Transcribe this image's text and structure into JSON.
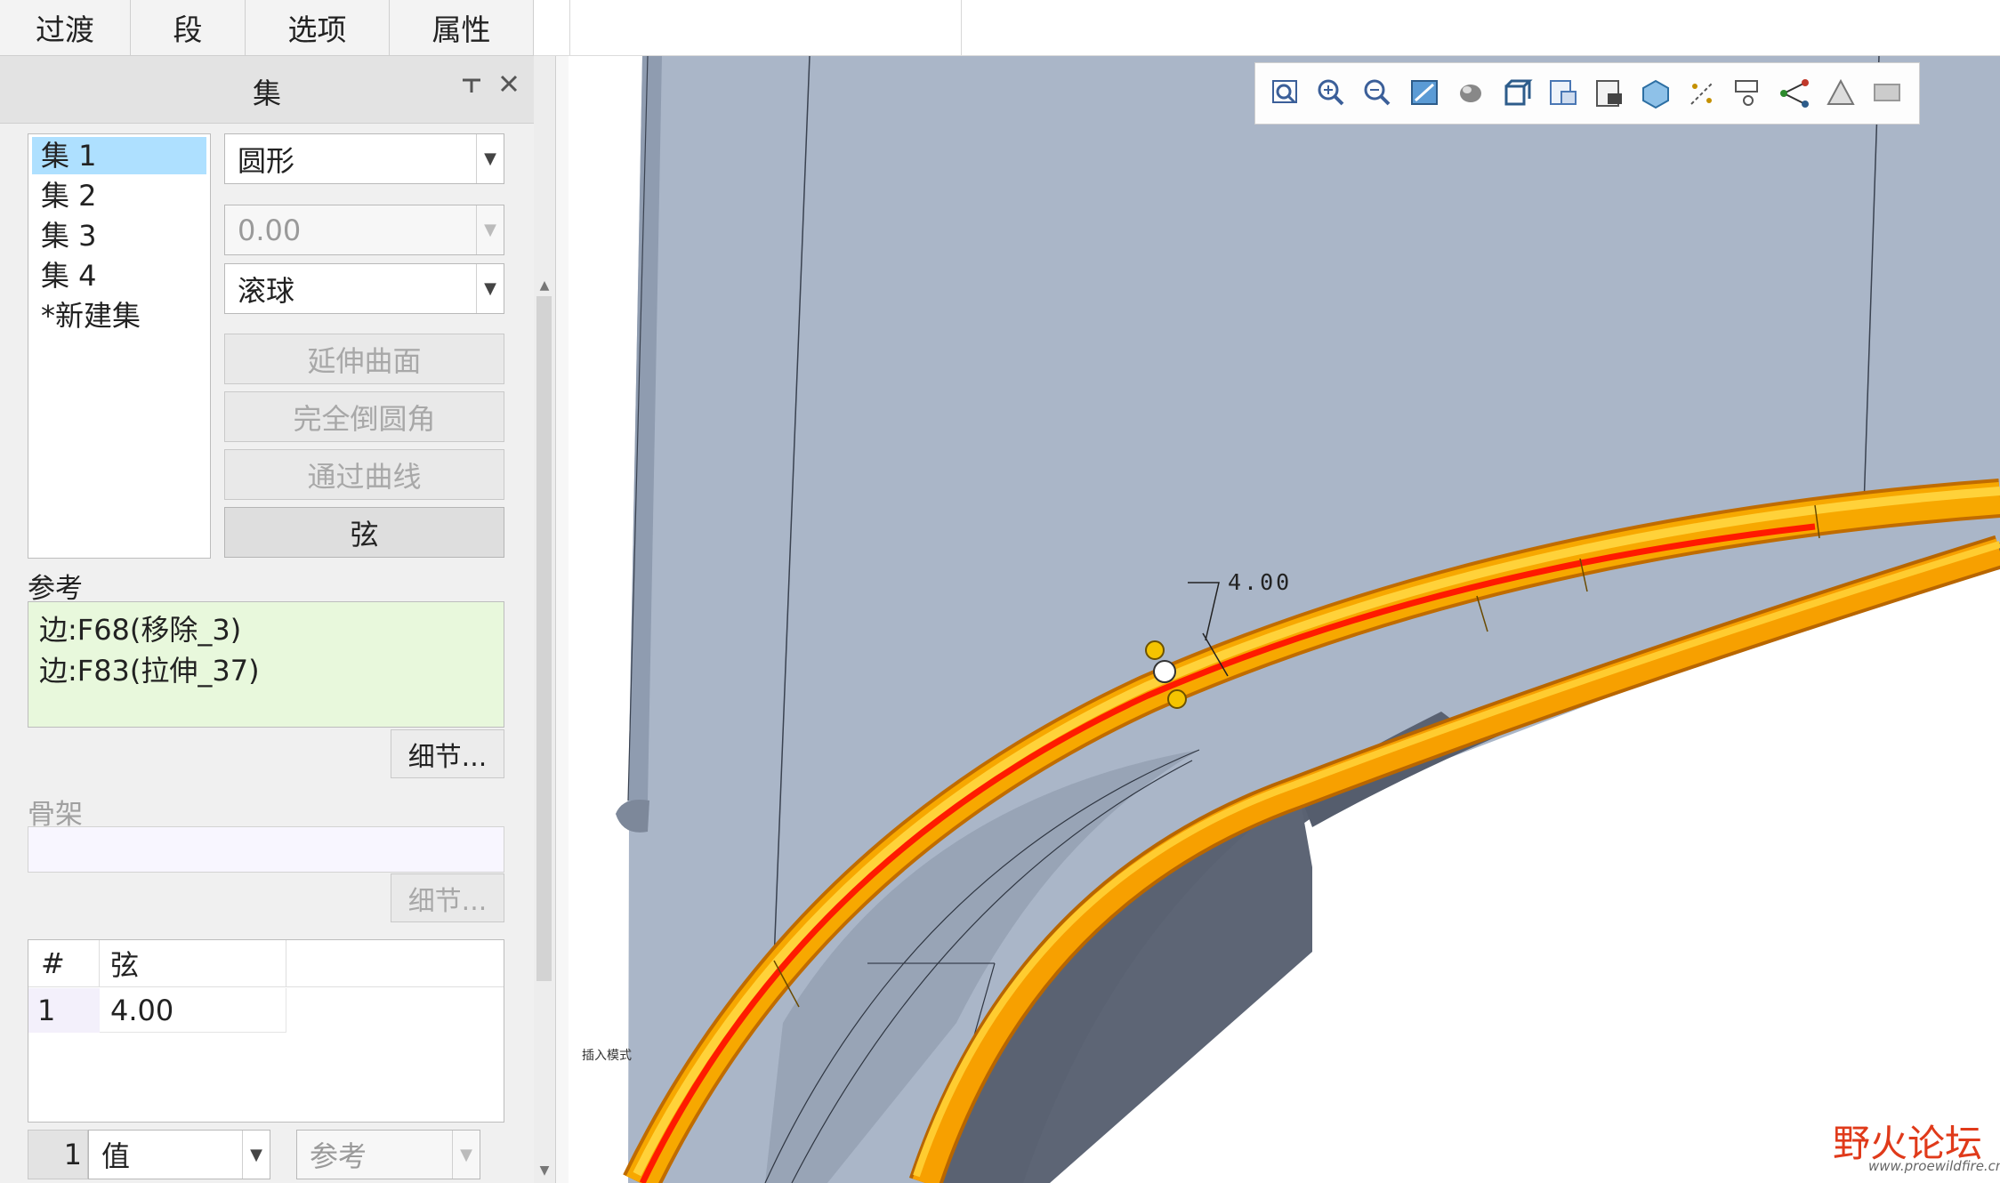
{
  "tabs": [
    "过渡",
    "段",
    "选项",
    "属性"
  ],
  "panel": {
    "title": "集",
    "pin_icon": "pin-icon",
    "close_icon": "close-icon",
    "sets": [
      "集 1",
      "集 2",
      "集 3",
      "集 4",
      "*新建集"
    ],
    "selected_set": "集 1",
    "shape_combo": "圆形",
    "value_combo": "0.00",
    "method_combo": "滚球",
    "buttons": [
      "延伸曲面",
      "完全倒圆角",
      "通过曲线",
      "弦"
    ],
    "references_label": "参考",
    "references": [
      "边:F68(移除_3)",
      "边:F83(拉伸_37)"
    ],
    "details_button": "细节...",
    "skeleton_label": "骨架",
    "skeleton_details_button": "细节...",
    "table": {
      "headers": [
        "#",
        "弦"
      ],
      "rows": [
        {
          "num": "1",
          "value": "4.00"
        }
      ]
    },
    "bottom": {
      "index": "1",
      "value_combo": "值",
      "ref_combo": "参考"
    }
  },
  "viewport": {
    "dimension_label": "4.00",
    "insert_mode_label": "插入模式",
    "toolbar_icons": [
      "refit-icon",
      "zoom-in-icon",
      "zoom-out-icon",
      "repaint-icon",
      "display-style-icon",
      "saved-orientations-icon",
      "view-manager-icon",
      "perspective-icon",
      "datum-display-icon",
      "annotation-display-icon",
      "point-display-icon",
      "csys-display-icon",
      "spin-center-icon",
      "appearance-icon"
    ],
    "colors": {
      "model": "#a9b5c6",
      "fillet": "#f5a800",
      "highlight_edge": "#ff1a00"
    }
  },
  "watermark": {
    "brand": "野火论坛",
    "url": "www.proewildfire.cn"
  }
}
